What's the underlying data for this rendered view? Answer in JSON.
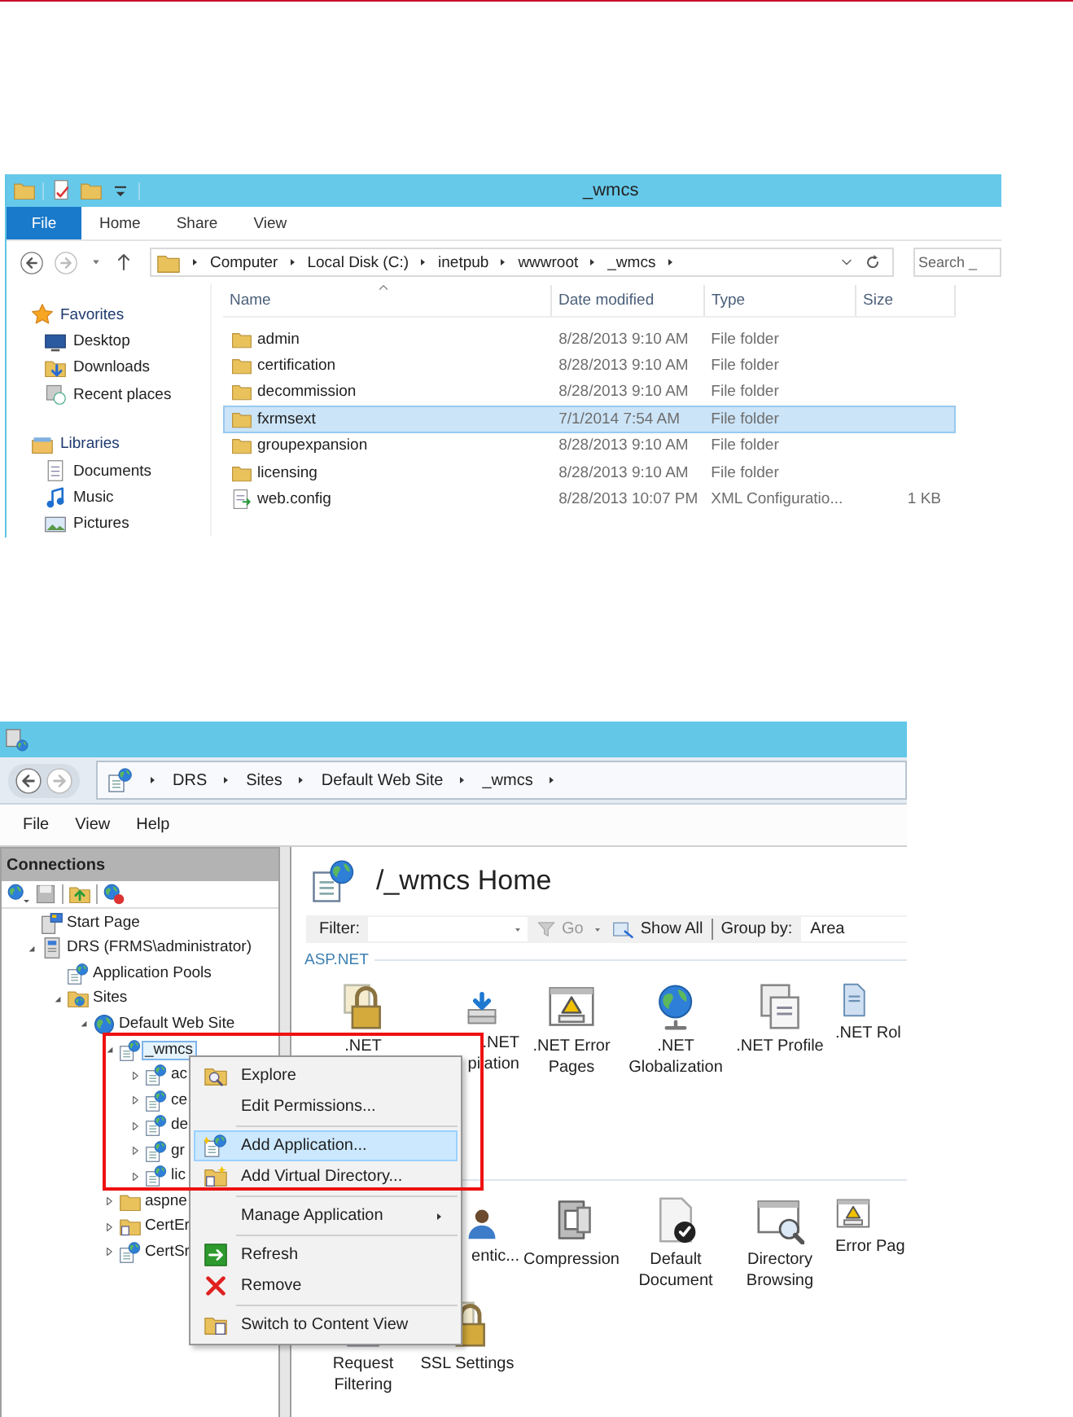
{
  "explorer": {
    "title": "_wmcs",
    "ribbon_tabs": [
      {
        "label": "File",
        "kind": "file"
      },
      {
        "label": "Home",
        "kind": "tab"
      },
      {
        "label": "Share",
        "kind": "tab"
      },
      {
        "label": "View",
        "kind": "tab"
      }
    ],
    "breadcrumb": [
      "Computer",
      "Local Disk (C:)",
      "inetpub",
      "wwwroot",
      "_wmcs"
    ],
    "search": {
      "placeholder": "Search _"
    },
    "nav": [
      {
        "label": "Favorites",
        "children": [
          {
            "label": "Desktop"
          },
          {
            "label": "Downloads"
          },
          {
            "label": "Recent places"
          }
        ]
      },
      {
        "label": "Libraries",
        "children": [
          {
            "label": "Documents"
          },
          {
            "label": "Music"
          },
          {
            "label": "Pictures"
          }
        ]
      }
    ],
    "columns": [
      "Name",
      "Date modified",
      "Type",
      "Size"
    ],
    "rows": [
      {
        "name": "admin",
        "kind": "folder",
        "date": "8/28/2013 9:10 AM",
        "type": "File folder",
        "selected": false
      },
      {
        "name": "certification",
        "kind": "folder",
        "date": "8/28/2013 9:10 AM",
        "type": "File folder",
        "selected": false
      },
      {
        "name": "decommission",
        "kind": "folder",
        "date": "8/28/2013 9:10 AM",
        "type": "File folder",
        "selected": false
      },
      {
        "name": "fxrmsext",
        "kind": "folder",
        "date": "7/1/2014 7:54 AM",
        "type": "File folder",
        "selected": true
      },
      {
        "name": "groupexpansion",
        "kind": "folder",
        "date": "8/28/2013 9:10 AM",
        "type": "File folder",
        "selected": false
      },
      {
        "name": "licensing",
        "kind": "folder",
        "date": "8/28/2013 9:10 AM",
        "type": "File folder",
        "selected": false
      },
      {
        "name": "web.config",
        "kind": "file",
        "date": "8/28/2013 10:07 PM",
        "type": "XML Configuratio...",
        "size": "1 KB",
        "selected": false
      }
    ]
  },
  "iis": {
    "breadcrumb": [
      "DRS",
      "Sites",
      "Default Web Site",
      "_wmcs"
    ],
    "menu": [
      "File",
      "View",
      "Help"
    ],
    "connections": {
      "title": "Connections",
      "tree": [
        {
          "label": "Start Page",
          "kind": "start",
          "selected": false
        },
        {
          "label": "DRS (FRMS\\administrator)",
          "kind": "server",
          "expanded": true,
          "selected": false,
          "children": [
            {
              "label": "Application Pools",
              "kind": "pool",
              "selected": false
            },
            {
              "label": "Sites",
              "kind": "sites",
              "expanded": true,
              "selected": false,
              "children": [
                {
                  "label": "Default Web Site",
                  "kind": "site",
                  "expanded": true,
                  "selected": false,
                  "children": [
                    {
                      "label": "_wmcs",
                      "kind": "app",
                      "expanded": true,
                      "selected": true,
                      "children": [
                        {
                          "label": "ac",
                          "kind": "app",
                          "expanded": false,
                          "selected": false
                        },
                        {
                          "label": "ce",
                          "kind": "app",
                          "expanded": false,
                          "selected": false
                        },
                        {
                          "label": "de",
                          "kind": "app",
                          "expanded": false,
                          "selected": false
                        },
                        {
                          "label": "gr",
                          "kind": "app",
                          "expanded": false,
                          "selected": false
                        },
                        {
                          "label": "lic",
                          "kind": "app",
                          "expanded": false,
                          "selected": false
                        }
                      ]
                    },
                    {
                      "label": "aspne",
                      "kind": "folder",
                      "expanded": false,
                      "selected": false
                    },
                    {
                      "label": "CertEr",
                      "kind": "vdir",
                      "expanded": false,
                      "selected": false
                    },
                    {
                      "label": "CertSr",
                      "kind": "app",
                      "expanded": false,
                      "selected": false
                    }
                  ]
                }
              ]
            }
          ]
        }
      ]
    },
    "home": {
      "title": "/_wmcs Home",
      "filter": {
        "label": "Filter:",
        "go": "Go",
        "show_all": "Show All",
        "group_by_label": "Group by:",
        "group_by": "Area"
      },
      "sections": [
        {
          "title": "ASP.NET",
          "features": [
            {
              "lines": [
                ".NET"
              ],
              "kind": "tile"
            },
            {
              "lines": [
                ".NET",
                "pilation"
              ],
              "kind": "cut-left"
            },
            {
              "lines": [
                ".NET Error",
                "Pages"
              ],
              "kind": "tile"
            },
            {
              "lines": [
                ".NET",
                "Globalization"
              ],
              "kind": "tile"
            },
            {
              "lines": [
                ".NET Profile"
              ],
              "kind": "tile"
            },
            {
              "lines": [
                ".NET Rol"
              ],
              "kind": "cut-right"
            }
          ]
        },
        {
          "features": [
            {
              "lines": [
                "entic..."
              ],
              "kind": "cut-left"
            },
            {
              "lines": [
                "Compression"
              ],
              "kind": "tile"
            },
            {
              "lines": [
                "Default",
                "Document"
              ],
              "kind": "tile"
            },
            {
              "lines": [
                "Directory",
                "Browsing"
              ],
              "kind": "tile"
            },
            {
              "lines": [
                "Error Pag"
              ],
              "kind": "cut-right"
            },
            {
              "lines": [
                "Request",
                "Filtering"
              ],
              "kind": "tile"
            },
            {
              "lines": [
                "SSL Settings"
              ],
              "kind": "tile"
            }
          ]
        }
      ]
    },
    "context_menu": [
      {
        "kind": "item",
        "label": "Explore",
        "selected": false
      },
      {
        "kind": "item",
        "label": "Edit Permissions...",
        "selected": false
      },
      {
        "kind": "separator"
      },
      {
        "kind": "item",
        "label": "Add Application...",
        "selected": true
      },
      {
        "kind": "item",
        "label": "Add Virtual Directory...",
        "selected": false
      },
      {
        "kind": "separator"
      },
      {
        "kind": "submenu",
        "label": "Manage Application",
        "selected": false
      },
      {
        "kind": "separator"
      },
      {
        "kind": "item",
        "label": "Refresh",
        "selected": false
      },
      {
        "kind": "item",
        "label": "Remove",
        "selected": false
      },
      {
        "kind": "separator"
      },
      {
        "kind": "item",
        "label": "Switch to Content View",
        "selected": false
      }
    ]
  }
}
